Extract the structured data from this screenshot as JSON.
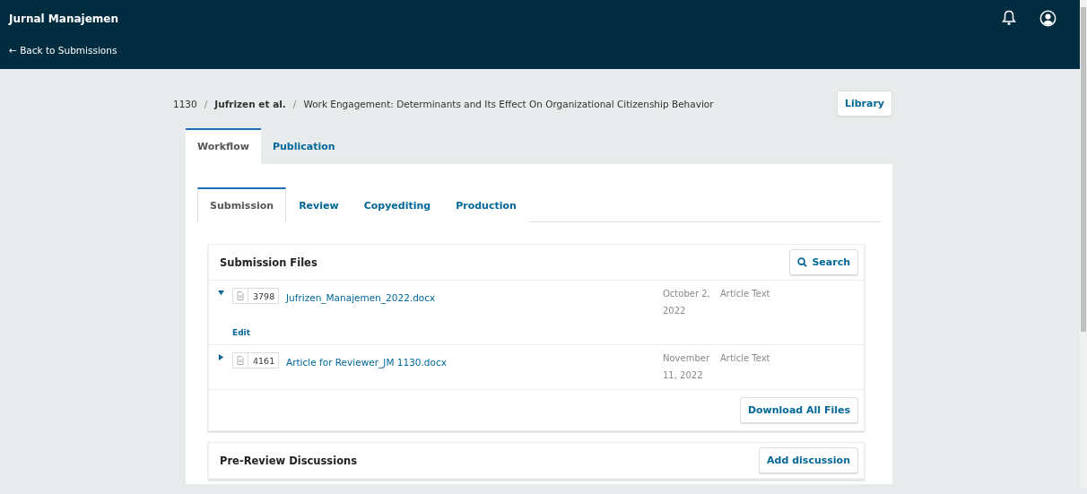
{
  "header": {
    "title": "Jurnal Manajemen",
    "back_link": "← Back to Submissions"
  },
  "breadcrumb": {
    "id": "1130",
    "separator": "/",
    "authors": "Jufrizen et al.",
    "title": "Work Engagement: Determinants and Its Effect On Organizational Citizenship Behavior",
    "library_button": "Library"
  },
  "tabs": [
    {
      "label": "Workflow",
      "selected": true
    },
    {
      "label": "Publication",
      "selected": false
    }
  ],
  "subtabs": [
    {
      "label": "Submission",
      "selected": true
    },
    {
      "label": "Review",
      "selected": false
    },
    {
      "label": "Copyediting",
      "selected": false
    },
    {
      "label": "Production",
      "selected": false
    }
  ],
  "submission_files": {
    "title": "Submission Files",
    "search_button": "Search",
    "files": [
      {
        "id": "3798",
        "name": "Jufrizen_Manajemen_2022.docx",
        "date": "October 2, 2022",
        "type": "Article Text",
        "expanded": true,
        "action": "Edit"
      },
      {
        "id": "4161",
        "name": "Article for Reviewer_JM 1130.docx",
        "date": "November 11, 2022",
        "type": "Article Text",
        "expanded": false
      }
    ],
    "download_button": "Download All Files"
  },
  "discussions": {
    "title": "Pre-Review Discussions",
    "add_button": "Add discussion"
  }
}
